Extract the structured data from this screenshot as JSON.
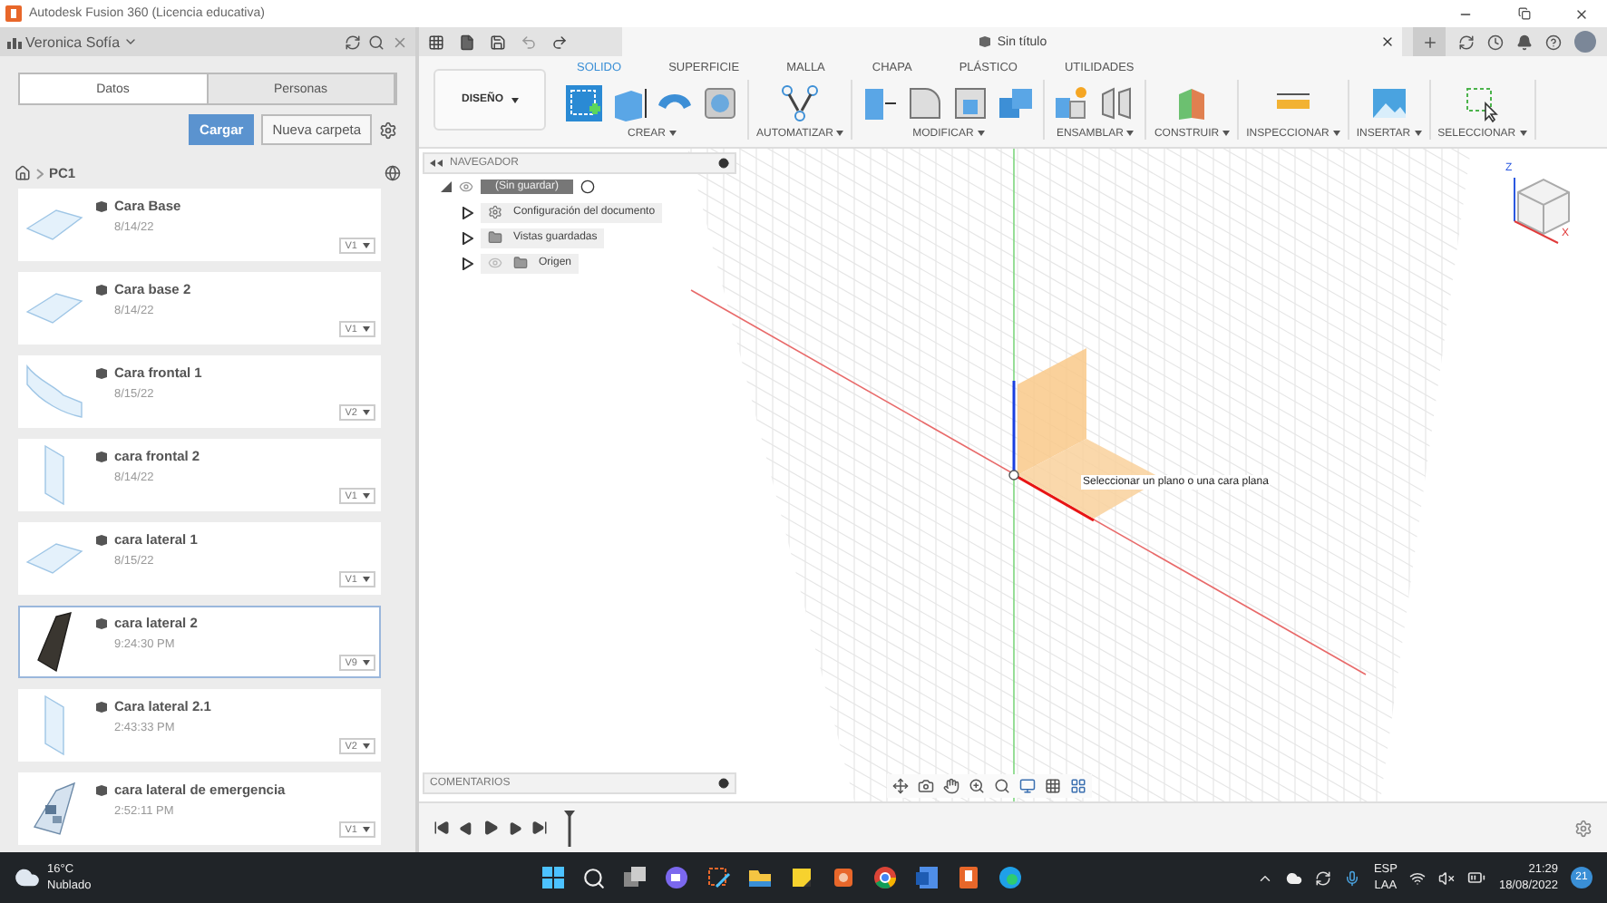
{
  "window": {
    "title": "Autodesk Fusion 360 (Licencia educativa)"
  },
  "data_panel": {
    "user": "Veronica Sofía",
    "tabs": [
      {
        "label": "Datos",
        "selected": true
      },
      {
        "label": "Personas",
        "selected": false
      }
    ],
    "upload_button": "Cargar",
    "new_folder_button": "Nueva carpeta",
    "breadcrumb": "PC1",
    "files": [
      {
        "name": "Cara Base",
        "date": "8/14/22",
        "version": "V1",
        "selected": false,
        "kind": "flat"
      },
      {
        "name": "Cara base 2",
        "date": "8/14/22",
        "version": "V1",
        "selected": false,
        "kind": "flat"
      },
      {
        "name": "Cara frontal 1",
        "date": "8/15/22",
        "version": "V2",
        "selected": false,
        "kind": "curved"
      },
      {
        "name": "cara frontal 2",
        "date": "8/14/22",
        "version": "V1",
        "selected": false,
        "kind": "upright"
      },
      {
        "name": "cara lateral 1",
        "date": "8/15/22",
        "version": "V1",
        "selected": false,
        "kind": "flat"
      },
      {
        "name": "cara lateral 2",
        "date": "9:24:30 PM",
        "version": "V9",
        "selected": true,
        "kind": "dark"
      },
      {
        "name": "Cara lateral 2.1",
        "date": "2:43:33 PM",
        "version": "V2",
        "selected": false,
        "kind": "upright"
      },
      {
        "name": "cara lateral de emergencia",
        "date": "2:52:11 PM",
        "version": "V1",
        "selected": false,
        "kind": "detailed"
      }
    ]
  },
  "toolbar": {
    "document_tab": "Sin título"
  },
  "ribbon": {
    "workspace": "DISEÑO",
    "tabs": [
      {
        "label": "SOLIDO",
        "selected": true
      },
      {
        "label": "SUPERFICIE",
        "selected": false
      },
      {
        "label": "MALLA",
        "selected": false
      },
      {
        "label": "CHAPA",
        "selected": false
      },
      {
        "label": "PLÁSTICO",
        "selected": false
      },
      {
        "label": "UTILIDADES",
        "selected": false
      }
    ],
    "groups": [
      {
        "label": "CREAR",
        "kind": "create"
      },
      {
        "label": "AUTOMATIZAR",
        "kind": "automate"
      },
      {
        "label": "MODIFICAR",
        "kind": "modify"
      },
      {
        "label": "ENSAMBLAR",
        "kind": "assemble"
      },
      {
        "label": "CONSTRUIR",
        "kind": "construct"
      },
      {
        "label": "INSPECCIONAR",
        "kind": "inspect"
      },
      {
        "label": "INSERTAR",
        "kind": "insert"
      },
      {
        "label": "SELECCIONAR",
        "kind": "select"
      }
    ]
  },
  "navigator": {
    "title": "NAVEGADOR",
    "root": "(Sin guardar)",
    "items": [
      {
        "label": "Configuración del documento",
        "kind": "settings"
      },
      {
        "label": "Vistas guardadas",
        "kind": "folder"
      },
      {
        "label": "Origen",
        "kind": "hidden-folder"
      }
    ]
  },
  "viewport": {
    "tooltip": "Seleccionar un plano o una cara plana",
    "viewcube": {
      "z_label": "Z",
      "x_label": "X"
    }
  },
  "comments": {
    "title": "COMENTARIOS"
  },
  "taskbar": {
    "temperature": "16°C",
    "weather": "Nublado",
    "language": "ESP",
    "layout": "LAA",
    "time": "21:29",
    "date": "18/08/2022",
    "notifications": "21"
  }
}
